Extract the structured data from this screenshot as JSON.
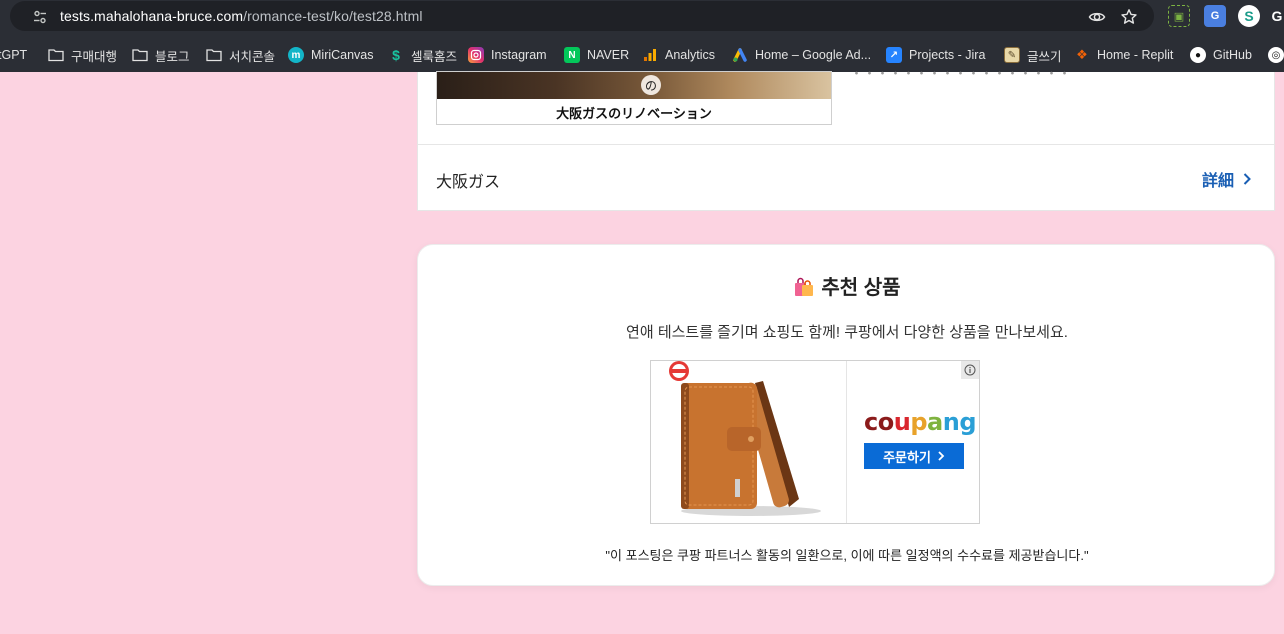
{
  "browser": {
    "url_host": "tests.mahalohana-bruce.com",
    "url_path": "/romance-test/ko/test28.html",
    "bookmarks": [
      {
        "label": "tGPT",
        "icon": "chatgpt-icon"
      },
      {
        "label": "구매대행",
        "icon": "folder-icon"
      },
      {
        "label": "블로그",
        "icon": "folder-icon"
      },
      {
        "label": "서치콘솔",
        "icon": "folder-icon"
      },
      {
        "label": "MiriCanvas",
        "icon": "miricanvas-icon"
      },
      {
        "label": "셀룩홈즈",
        "icon": "sellook-icon"
      },
      {
        "label": "Instagram",
        "icon": "instagram-icon"
      },
      {
        "label": "NAVER",
        "icon": "naver-icon"
      },
      {
        "label": "Analytics",
        "icon": "analytics-icon"
      },
      {
        "label": "Home – Google Ad...",
        "icon": "google-ads-icon"
      },
      {
        "label": "Projects - Jira",
        "icon": "jira-icon"
      },
      {
        "label": "글쓰기",
        "icon": "write-icon"
      },
      {
        "label": "Home - Replit",
        "icon": "replit-icon"
      },
      {
        "label": "GitHub",
        "icon": "github-icon"
      }
    ]
  },
  "top_ad": {
    "image_caption": "大阪ガスのリノベーション",
    "image_badge": "の",
    "faded_text": "・・・・・・・・・・・・・・・・・",
    "advertiser": "大阪ガス",
    "details_label": "詳細"
  },
  "recommend": {
    "title": "추천 상품",
    "description": "연애 테스트를 즐기며 쇼핑도 함께! 쿠팡에서 다양한 상품을 만나보세요.",
    "order_label": "주문하기",
    "disclaimer": "\"이 포스팅은 쿠팡 파트너스 활동의 일환으로, 이에 따른 일정액의 수수료를 제공받습니다.\""
  },
  "coupang_logo": {
    "letters": [
      "c",
      "o",
      "u",
      "p",
      "a",
      "n",
      "g"
    ],
    "colors": [
      "#8b1b1b",
      "#8b1b1b",
      "#d9272e",
      "#e8a22a",
      "#7fb33f",
      "#2a9fd6",
      "#2a9fd6"
    ]
  },
  "colors": {
    "page_background": "#fcd3e1",
    "link": "#1a5fb4",
    "coupang_button": "#0a6bd6"
  }
}
